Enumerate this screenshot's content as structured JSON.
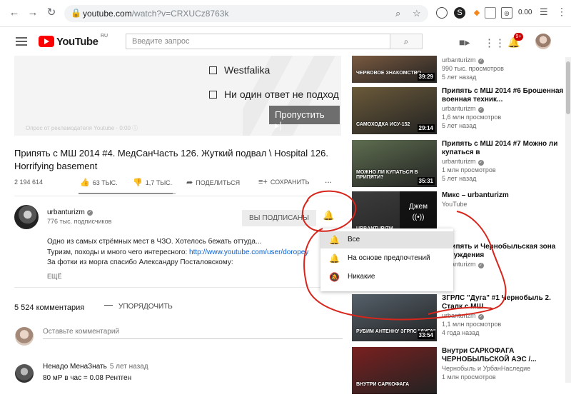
{
  "browser": {
    "url_host": "youtube.com",
    "url_path": "/watch?v=CRXUCz8763k",
    "ext_amount": "0.00"
  },
  "header": {
    "logo_text": "YouTube",
    "logo_region": "RU",
    "search_placeholder": "Введите запрос",
    "notif_count": "9+"
  },
  "player": {
    "survey_options": [
      "Westfalika",
      "Ни один ответ не подход"
    ],
    "skip_label": "Пропустить ▸|",
    "ad_note": "Опрос от рекламодателя Youtube · 0:00 ⓘ"
  },
  "video": {
    "title": "Припять с МШ 2014 #4. МедСанЧасть 126. Жуткий подвал \\ Hospital 126. Horrifying basement",
    "views": "2 194 614",
    "likes": "63 ТЫС.",
    "dislikes": "1,7 ТЫС.",
    "like_ratio": 0.97,
    "share_label": "ПОДЕЛИТЬСЯ",
    "save_label": "СОХРАНИТЬ",
    "more_label": "..."
  },
  "channel": {
    "name": "urbanturizm",
    "subs": "776 тыс. подписчиков",
    "subscribed_label": "ВЫ ПОДПИСАНЫ",
    "desc_line1": "Одно из самых стрёмных мест в ЧЗО. Хотелось бежать оттуда...",
    "desc_line2_text": "Туризм, походы и много чего интересного: ",
    "desc_line2_link": "http://www.youtube.com/user/doropey",
    "desc_line3": "За фотки из морга спасибо Александру Посталовскому:",
    "more_label": "ЕЩЁ"
  },
  "bell_menu": {
    "items": [
      {
        "label": "Все",
        "icon": "bell-ring-icon",
        "selected": true
      },
      {
        "label": "На основе предпочтений",
        "icon": "bell-icon",
        "selected": false
      },
      {
        "label": "Никакие",
        "icon": "bell-off-icon",
        "selected": false
      }
    ]
  },
  "comments": {
    "count_label": "5 524 комментария",
    "sort_label": "УПОРЯДОЧИТЬ",
    "add_placeholder": "Оставьте комментарий",
    "first": {
      "author": "Ненадо МенаЗнать",
      "time": "5 лет назад",
      "text": "80 мР в час = 0.08 Рентген"
    }
  },
  "sidebar": [
    {
      "title": "",
      "channel": "urbanturizm",
      "views": "990 тыс. просмотров",
      "age": "5 лет назад",
      "duration": "39:29",
      "caption": "ЧЕРВОВОЕ ЗНАКОМСТВО",
      "theme": "#7a5a40"
    },
    {
      "title": "Припять с МШ 2014 #6 Брошенная военная техник...",
      "channel": "urbanturizm",
      "views": "1,6 млн просмотров",
      "age": "5 лет назад",
      "duration": "29:14",
      "caption": "САМОХОДКА ИСУ-152",
      "theme": "#6b5a3a"
    },
    {
      "title": "Припять с МШ 2014 #7 Можно ли купаться в",
      "channel": "urbanturizm",
      "views": "1 млн просмотров",
      "age": "5 лет назад",
      "duration": "35:31",
      "caption": "МОЖНО ЛИ КУПАТЬСЯ В ПРИПЯТИ?",
      "theme": "#5e6e50"
    },
    {
      "title": "Микс – urbanturizm",
      "channel": "YouTube",
      "views": "",
      "age": "",
      "duration": "",
      "caption": "URBANTURIZM",
      "theme": "#3c3c3c",
      "mix_label": "Джем"
    },
    {
      "title": "Припять и Чернобыльская зона отчуждения",
      "channel": "urbanturizm",
      "views": "",
      "age": "",
      "duration": "",
      "caption": "",
      "theme": "#888"
    },
    {
      "title": "ЗГРЛС \"Дуга\" #1 Чернобыль 2. Сталк с МШ....",
      "channel": "urbanturizm",
      "views": "1,1 млн просмотров",
      "age": "4 года назад",
      "duration": "33:54",
      "caption": "РУБИМ АНТЕННУ ЗГРЛС \"ДУГА\"",
      "theme": "#55606a"
    },
    {
      "title": "Внутри САРКОФАГА ЧЕРНОБЫЛЬСКОЙ АЭС /...",
      "channel": "Чернобыль и УрбанНаследие",
      "views": "1 млн просмотров",
      "age": "",
      "duration": "",
      "caption": "ВНУТРИ САРКОФАГА",
      "theme": "#7a2020"
    }
  ],
  "colors": {
    "annotation_red": "#d6261c",
    "youtube_red": "#ff0000",
    "link_blue": "#065fd4"
  }
}
